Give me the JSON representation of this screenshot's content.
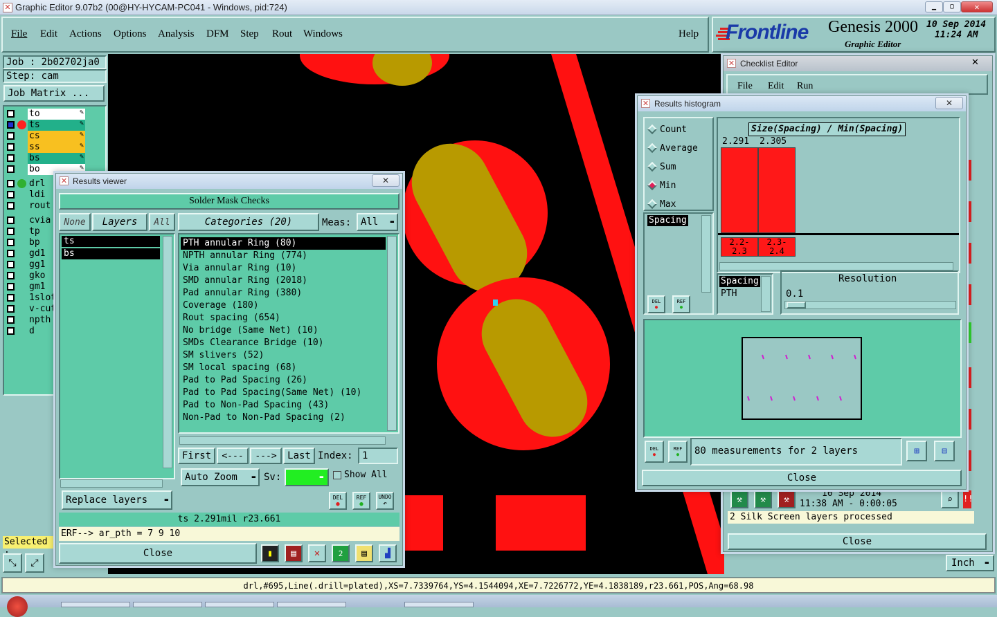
{
  "app": {
    "title": "Graphic Editor 9.07b2 (00@HY-HYCAM-PC041 - Windows, pid:724)",
    "brand": "Frontline",
    "product": "Genesis 2000",
    "product_sub": "Graphic Editor",
    "date": "10 Sep 2014",
    "time": "11:24 AM"
  },
  "menu": {
    "items": [
      "File",
      "Edit",
      "Actions",
      "Options",
      "Analysis",
      "DFM",
      "Step",
      "Rout",
      "Windows"
    ],
    "help": "Help"
  },
  "left": {
    "job": "Job : 2b02702ja0",
    "step": "Step: cam",
    "job_matrix": "Job Matrix ...",
    "layers": [
      "to",
      "ts",
      "cs",
      "ss",
      "bs",
      "bo",
      "drl",
      "ldi",
      "rout",
      "cvia",
      "tp",
      "bp",
      "gd1",
      "gg1",
      "gko",
      "gm1",
      "1slot",
      "v-cut",
      "npth",
      "d"
    ],
    "selected_label": "Selected :"
  },
  "results_viewer": {
    "title": "Results viewer",
    "header": "Solder Mask Checks",
    "none_btn": "None",
    "layers_btn": "Layers",
    "all_btn": "All",
    "categories_btn": "Categories (20)",
    "meas_label": "Meas:",
    "meas_value": "All",
    "layer_list": [
      "ts",
      "bs"
    ],
    "categories": [
      "PTH annular Ring (80)",
      "NPTH annular Ring (774)",
      "Via annular Ring (10)",
      "SMD annular Ring (2018)",
      "Pad annular Ring (380)",
      "Coverage (180)",
      "Rout spacing (654)",
      "No bridge (Same Net) (10)",
      "SMDs Clearance Bridge (10)",
      "SM slivers (52)",
      "SM local spacing (68)",
      "Pad to Pad Spacing (26)",
      "Pad to Pad Spacing(Same Net) (10)",
      "Pad to Non-Pad Spacing (43)",
      "Non-Pad to Non-Pad Spacing (2)"
    ],
    "first": "First",
    "prev": "<---",
    "next": "--->",
    "last": "Last",
    "index_label": "Index:",
    "index_value": "1",
    "auto_zoom": "Auto Zoom",
    "sv_label": "Sv:",
    "show_all": "Show All",
    "replace_layers": "Replace layers",
    "del": "DEL",
    "ref": "REF",
    "undo": "UNDO",
    "status": "ts 2.291mil  r23.661",
    "erf": "ERF--> ar_pth = 7 9 10",
    "close": "Close"
  },
  "histogram": {
    "title": "Results histogram",
    "modes": [
      "Count",
      "Average",
      "Sum",
      "Min",
      "Max"
    ],
    "selected_mode": "Min",
    "field": "Spacing",
    "chart_title": "Size(Spacing) / Min(Spacing)",
    "bars": [
      {
        "value_label": "2.291",
        "range_top": "2.2-",
        "range_bottom": "2.3"
      },
      {
        "value_label": "2.305",
        "range_top": "2.3-",
        "range_bottom": "2.4"
      }
    ],
    "list_header": "Spacing",
    "list_item": "PTH",
    "resolution_label": "Resolution",
    "resolution_value": "0.1",
    "measurements": "80 measurements for 2 layers",
    "close": "Close"
  },
  "checklist": {
    "title": "Checklist Editor",
    "menu": [
      "File",
      "Edit",
      "Run"
    ],
    "date": "10 Sep 2014",
    "time": "11:38 AM - 0:00:05",
    "message": "2 Silk Screen layers processed",
    "close": "Close"
  },
  "units": "Inch",
  "statusbar": "drl,#695,Line(.drill=plated),XS=7.7339764,YS=4.1544094,XE=7.7226772,YE=4.1838189,r23.661,POS,Ang=68.98",
  "colors": {
    "teal": "#5ecba8",
    "pad": "#ff1111",
    "drill": "#b89a00",
    "canvas": "#000000"
  }
}
